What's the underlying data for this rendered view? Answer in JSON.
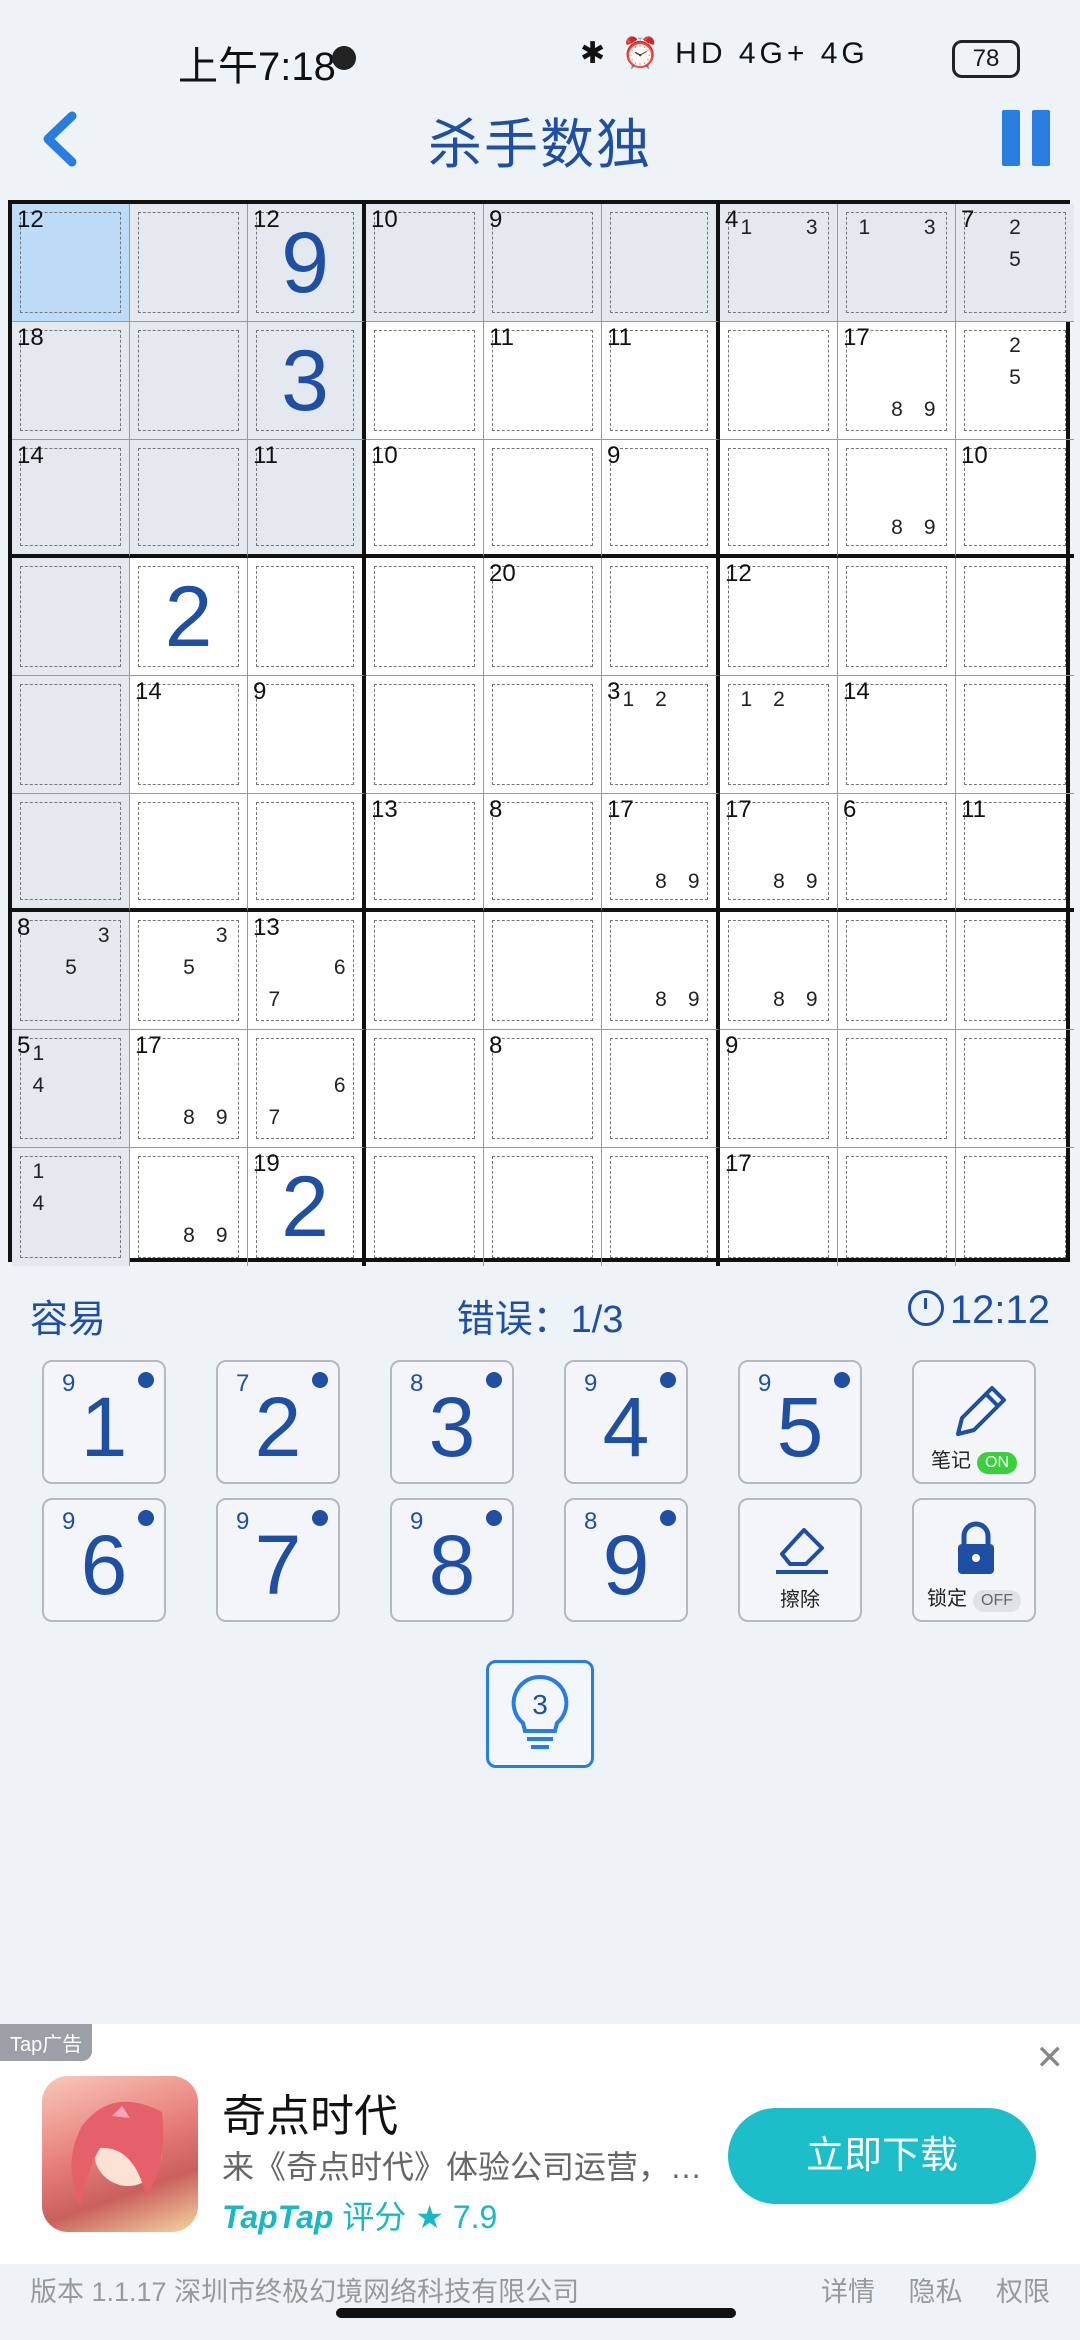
{
  "status_bar": {
    "time": "上午7:18",
    "network_icons": "✱ ⏰ HD 4G+ 4G",
    "battery": "78"
  },
  "header": {
    "title": "杀手数独"
  },
  "board": {
    "cells": [
      {
        "r": 0,
        "c": 0,
        "sum": "12",
        "sel": true
      },
      {
        "r": 0,
        "c": 1,
        "hl": true
      },
      {
        "r": 0,
        "c": 2,
        "sum": "12",
        "value": "9",
        "hl": true
      },
      {
        "r": 0,
        "c": 3,
        "sum": "10",
        "hl": true
      },
      {
        "r": 0,
        "c": 4,
        "sum": "9",
        "hl": true
      },
      {
        "r": 0,
        "c": 5,
        "hl": true
      },
      {
        "r": 0,
        "c": 6,
        "sum": "4",
        "hl": true,
        "notes": [
          "1",
          "3"
        ]
      },
      {
        "r": 0,
        "c": 7,
        "hl": true,
        "notes": [
          "1",
          "3"
        ]
      },
      {
        "r": 0,
        "c": 8,
        "sum": "7",
        "hl": true,
        "notes": [
          "2",
          "5"
        ]
      },
      {
        "r": 1,
        "c": 0,
        "sum": "18",
        "hl": true
      },
      {
        "r": 1,
        "c": 1,
        "hl": true
      },
      {
        "r": 1,
        "c": 2,
        "value": "3",
        "hl": true
      },
      {
        "r": 1,
        "c": 3
      },
      {
        "r": 1,
        "c": 4,
        "sum": "11"
      },
      {
        "r": 1,
        "c": 5,
        "sum": "11"
      },
      {
        "r": 1,
        "c": 6
      },
      {
        "r": 1,
        "c": 7,
        "sum": "17",
        "notes": [
          "8",
          "9"
        ]
      },
      {
        "r": 1,
        "c": 8,
        "notes": [
          "2",
          "5"
        ]
      },
      {
        "r": 2,
        "c": 0,
        "sum": "14",
        "hl": true
      },
      {
        "r": 2,
        "c": 1,
        "hl": true
      },
      {
        "r": 2,
        "c": 2,
        "sum": "11",
        "hl": true
      },
      {
        "r": 2,
        "c": 3,
        "sum": "10"
      },
      {
        "r": 2,
        "c": 4
      },
      {
        "r": 2,
        "c": 5,
        "sum": "9"
      },
      {
        "r": 2,
        "c": 6
      },
      {
        "r": 2,
        "c": 7,
        "notes": [
          "8",
          "9"
        ]
      },
      {
        "r": 2,
        "c": 8,
        "sum": "10"
      },
      {
        "r": 3,
        "c": 0,
        "hl": true
      },
      {
        "r": 3,
        "c": 1,
        "value": "2"
      },
      {
        "r": 3,
        "c": 2
      },
      {
        "r": 3,
        "c": 3
      },
      {
        "r": 3,
        "c": 4,
        "sum": "20"
      },
      {
        "r": 3,
        "c": 5
      },
      {
        "r": 3,
        "c": 6,
        "sum": "12"
      },
      {
        "r": 3,
        "c": 7
      },
      {
        "r": 3,
        "c": 8
      },
      {
        "r": 4,
        "c": 0,
        "hl": true
      },
      {
        "r": 4,
        "c": 1,
        "sum": "14"
      },
      {
        "r": 4,
        "c": 2,
        "sum": "9"
      },
      {
        "r": 4,
        "c": 3
      },
      {
        "r": 4,
        "c": 4
      },
      {
        "r": 4,
        "c": 5,
        "sum": "3",
        "notes": [
          "1",
          "2"
        ]
      },
      {
        "r": 4,
        "c": 6,
        "notes": [
          "1",
          "2"
        ]
      },
      {
        "r": 4,
        "c": 7,
        "sum": "14"
      },
      {
        "r": 4,
        "c": 8
      },
      {
        "r": 5,
        "c": 0,
        "hl": true
      },
      {
        "r": 5,
        "c": 1
      },
      {
        "r": 5,
        "c": 2
      },
      {
        "r": 5,
        "c": 3,
        "sum": "13"
      },
      {
        "r": 5,
        "c": 4,
        "sum": "8"
      },
      {
        "r": 5,
        "c": 5,
        "sum": "17",
        "notes": [
          "8",
          "9"
        ]
      },
      {
        "r": 5,
        "c": 6,
        "sum": "17",
        "notes": [
          "8",
          "9"
        ]
      },
      {
        "r": 5,
        "c": 7,
        "sum": "6"
      },
      {
        "r": 5,
        "c": 8,
        "sum": "11"
      },
      {
        "r": 6,
        "c": 0,
        "sum": "8",
        "hl": true,
        "notes": [
          "3",
          "5"
        ]
      },
      {
        "r": 6,
        "c": 1,
        "notes": [
          "3",
          "5"
        ]
      },
      {
        "r": 6,
        "c": 2,
        "sum": "13",
        "notes": [
          "6",
          "7"
        ]
      },
      {
        "r": 6,
        "c": 3
      },
      {
        "r": 6,
        "c": 4
      },
      {
        "r": 6,
        "c": 5,
        "notes": [
          "8",
          "9"
        ]
      },
      {
        "r": 6,
        "c": 6,
        "notes": [
          "8",
          "9"
        ]
      },
      {
        "r": 6,
        "c": 7
      },
      {
        "r": 6,
        "c": 8
      },
      {
        "r": 7,
        "c": 0,
        "sum": "5",
        "hl": true,
        "notes": [
          "1",
          "4"
        ]
      },
      {
        "r": 7,
        "c": 1,
        "sum": "17",
        "notes": [
          "8",
          "9"
        ]
      },
      {
        "r": 7,
        "c": 2,
        "notes": [
          "6",
          "7"
        ]
      },
      {
        "r": 7,
        "c": 3
      },
      {
        "r": 7,
        "c": 4,
        "sum": "8"
      },
      {
        "r": 7,
        "c": 5
      },
      {
        "r": 7,
        "c": 6,
        "sum": "9"
      },
      {
        "r": 7,
        "c": 7
      },
      {
        "r": 7,
        "c": 8
      },
      {
        "r": 8,
        "c": 0,
        "hl": true,
        "notes": [
          "1",
          "4"
        ]
      },
      {
        "r": 8,
        "c": 1,
        "notes": [
          "8",
          "9"
        ]
      },
      {
        "r": 8,
        "c": 2,
        "sum": "19",
        "value": "2"
      },
      {
        "r": 8,
        "c": 3
      },
      {
        "r": 8,
        "c": 4
      },
      {
        "r": 8,
        "c": 5
      },
      {
        "r": 8,
        "c": 6,
        "sum": "17"
      },
      {
        "r": 8,
        "c": 7
      },
      {
        "r": 8,
        "c": 8
      }
    ]
  },
  "info": {
    "difficulty": "容易",
    "errors": "错误：1/3",
    "timer": "12:12"
  },
  "keypad": [
    {
      "num": "1",
      "count": "9"
    },
    {
      "num": "2",
      "count": "7"
    },
    {
      "num": "3",
      "count": "8"
    },
    {
      "num": "4",
      "count": "9"
    },
    {
      "num": "5",
      "count": "9"
    },
    {
      "num": "6",
      "count": "9"
    },
    {
      "num": "7",
      "count": "9"
    },
    {
      "num": "8",
      "count": "9"
    },
    {
      "num": "9",
      "count": "8"
    }
  ],
  "tools": {
    "notes": {
      "label": "笔记",
      "state": "ON"
    },
    "erase": {
      "label": "擦除"
    },
    "lock": {
      "label": "锁定",
      "state": "OFF"
    },
    "hint": {
      "count": "3"
    }
  },
  "ad": {
    "tag": "Tap广告",
    "close": "✕",
    "app_name": "奇点时代",
    "description": "来《奇点时代》体验公司运营，…",
    "brand": "TapTap",
    "rating_label": "评分",
    "rating": "★ 7.9",
    "cta": "立即下载"
  },
  "footer": {
    "version": "版本 1.1.17   深圳市终极幻境网络科技有限公司",
    "links": [
      "详情",
      "隐私",
      "权限"
    ]
  },
  "colors": {
    "accent": "#1f4fa3",
    "selected": "#bcdcf7",
    "highlight": "#e4e8ef",
    "cta": "#1bbec9"
  }
}
